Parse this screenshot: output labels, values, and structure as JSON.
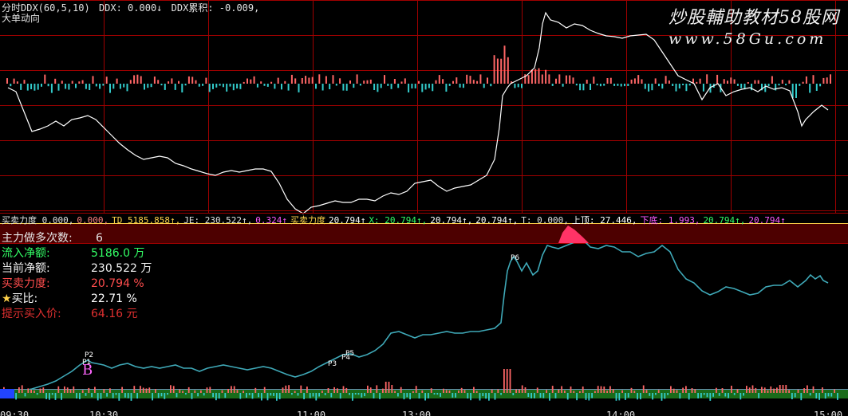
{
  "header": {
    "indicator": "分时DDX(60,5,10)",
    "ddx": "DDX: 0.000↓",
    "ddx_cum": "DDX累积: -0.009,",
    "subtitle": "大单动向"
  },
  "watermark": {
    "title": "炒股輔助教材58股网",
    "url": "www.58Gu.com"
  },
  "mid_bar": {
    "items": [
      {
        "text": "买卖力度 0.000,",
        "color": "#e0e0e0"
      },
      {
        "text": "0.000,",
        "color": "#ff8080"
      },
      {
        "text": "TD  5185.858↑,",
        "color": "#ffd24a"
      },
      {
        "text": "JE: 230.522↑,",
        "color": "#e0e0e0"
      },
      {
        "text": "0.324↑",
        "color": "#ff5aff"
      },
      {
        "text": "买卖力度",
        "color": "#ffd24a"
      },
      {
        "text": "20.794↑",
        "color": "#ffffff"
      },
      {
        "text": "X: 20.794↑,",
        "color": "#33ff66"
      },
      {
        "text": "20.794↑,",
        "color": "#ffffff"
      },
      {
        "text": "20.794↑,",
        "color": "#ffffff"
      },
      {
        "text": "T: 0.000,",
        "color": "#e0e0e0"
      },
      {
        "text": "上顶: 27.446,",
        "color": "#ffffff"
      },
      {
        "text": "下底: 1.993,",
        "color": "#ff5aff"
      },
      {
        "text": "20.794↑,",
        "color": "#33ff66"
      },
      {
        "text": "20.794↑",
        "color": "#ff5aff"
      }
    ]
  },
  "info_panel": [
    {
      "label": "主力做多次数:",
      "value": "6",
      "color": "#e6e6e6"
    },
    {
      "label": "流入净额:",
      "value": "5186.0 万",
      "color": "#33ff66"
    },
    {
      "label": "当前净额:",
      "value": "230.522 万",
      "color": "#f2f2f2"
    },
    {
      "label": "买卖力度:",
      "value": "20.794 %",
      "color": "#ff4d4d"
    },
    {
      "label": "★买比:",
      "value": "22.71 %",
      "color": "#ffffff",
      "star_color": "#ffd24a"
    },
    {
      "label": "提示买入价:",
      "value": "64.16 元",
      "color": "#e03030"
    }
  ],
  "time_axis": [
    "09:30",
    "10:30",
    "11:00",
    "13:00",
    "14:00",
    "15:00"
  ],
  "markers": [
    "P2",
    "P1",
    "B",
    "P3",
    "P4",
    "P5",
    "P6"
  ],
  "colors": {
    "grid_red": "#a00000",
    "ddx_line": "#ffffff",
    "bottom_line": "#3fa9b8",
    "band_fill": "#4d0000",
    "pink_spike": "#ff3366",
    "bar_up": "#ff6666",
    "bar_down": "#33cccc",
    "volume_green": "#1a6b1a"
  }
}
